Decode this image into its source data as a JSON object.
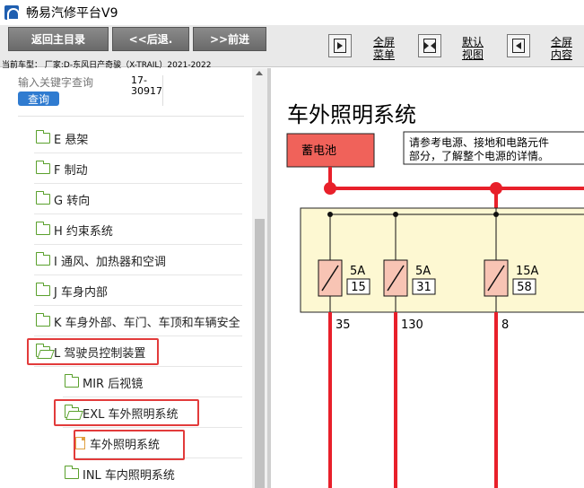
{
  "window": {
    "title": "畅易汽修平台V9"
  },
  "toolbar": {
    "home_label": "返回主目录",
    "back_label": "<<后退.",
    "forward_label": ">>前进",
    "model_info": "当前车型： 厂家:D-东风日产奇骏（X-TRAIL）2021-2022",
    "view_fullscreen_menu": "全屏\n菜单",
    "view_default": "默认\n视图",
    "view_fullscreen_content": "全屏\n内容"
  },
  "search": {
    "placeholder": "输入关键字查询",
    "button_label": "查询",
    "doc_code": "17-30917"
  },
  "tree": [
    {
      "label": "E 悬架",
      "type": "folder",
      "level": 0
    },
    {
      "label": "F 制动",
      "type": "folder",
      "level": 0
    },
    {
      "label": "G 转向",
      "type": "folder",
      "level": 0
    },
    {
      "label": "H 约束系统",
      "type": "folder",
      "level": 0
    },
    {
      "label": "I 通风、加热器和空调",
      "type": "folder",
      "level": 0
    },
    {
      "label": "J 车身内部",
      "type": "folder",
      "level": 0
    },
    {
      "label": "K 车身外部、车门、车顶和车辆安全",
      "type": "folder",
      "level": 0
    },
    {
      "label": "L 驾驶员控制装置",
      "type": "folder-open",
      "level": 0,
      "highlighted": true
    },
    {
      "label": "MIR 后视镜",
      "type": "folder",
      "level": 1
    },
    {
      "label": "EXL 车外照明系统",
      "type": "folder-open",
      "level": 1,
      "highlighted": true
    },
    {
      "label": "车外照明系统",
      "type": "file",
      "level": 2,
      "highlighted": true
    },
    {
      "label": "INL 车内照明系统",
      "type": "folder",
      "level": 1
    }
  ],
  "diagram": {
    "title": "车外照明系统",
    "battery_label": "蓄电池",
    "note": "请参考电源、接地和电路元件\n部分，了解整个电源的详情。",
    "fuses": [
      {
        "amp": "5A",
        "number": "15",
        "wire": "35"
      },
      {
        "amp": "5A",
        "number": "31",
        "wire": "130"
      },
      {
        "amp": "15A",
        "number": "58",
        "wire": "8"
      }
    ],
    "colors": {
      "wire": "#e8202a",
      "battery": "#f0625a",
      "fuse_box": "#fdf8d2",
      "fuse": "#f8c4b4",
      "highlight": "#e23b3b"
    }
  }
}
